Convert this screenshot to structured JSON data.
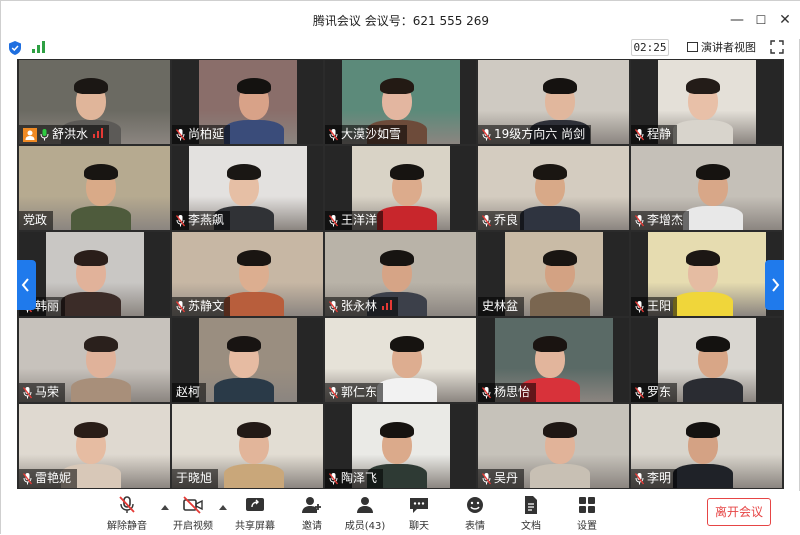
{
  "window": {
    "title": "腾讯会议 会议号：621 555 269"
  },
  "controls": {
    "minimize": "—",
    "maximize": "☐",
    "close": "✕"
  },
  "status": {
    "timer": "02:25",
    "speaker_view": "演讲者视图"
  },
  "participants": [
    {
      "name": "舒洪水",
      "tone": "#6b6a62",
      "skin": "#e0b59a",
      "hair": "#1b1714",
      "shirt": "#5c5a57",
      "accent": "#2b74d8"
    },
    {
      "name": "尚柏延",
      "tone": "#8a6e6a",
      "skin": "#d8a288",
      "hair": "#141210",
      "shirt": "#3a4c7a"
    },
    {
      "name": "大漠沙如雪",
      "tone": "#5c8a7a",
      "skin": "#e3b6a0",
      "hair": "#231a14",
      "shirt": "#6d4b3a"
    },
    {
      "name": "19级方向六 尚剑",
      "tone": "#cfcac2",
      "skin": "#e1b79d",
      "hair": "#151210",
      "shirt": "#2e3038"
    },
    {
      "name": "程静",
      "tone": "#e4e0d8",
      "skin": "#e8c0a8",
      "hair": "#231c18",
      "shirt": "#d8d4cc"
    },
    {
      "name": "党政",
      "tone": "#b6aa90",
      "skin": "#d9aa88",
      "hair": "#181512",
      "shirt": "#4e5b3c"
    },
    {
      "name": "李燕飙",
      "tone": "#e3e1df",
      "skin": "#e6bfa5",
      "hair": "#1a1714",
      "shirt": "#303236"
    },
    {
      "name": "王洋洋",
      "tone": "#d9d3c6",
      "skin": "#dcab8c",
      "hair": "#171411",
      "shirt": "#c8262c"
    },
    {
      "name": "乔良",
      "tone": "#d4ccc0",
      "skin": "#d8a988",
      "hair": "#1a1612",
      "shirt": "#2f3440"
    },
    {
      "name": "李增杰",
      "tone": "#c5c0b8",
      "skin": "#d8a788",
      "hair": "#161310",
      "shirt": "#e8e8e8"
    },
    {
      "name": "韩丽",
      "tone": "#c9c7c4",
      "skin": "#e1b29a",
      "hair": "#2a1e1a",
      "shirt": "#3b2c28"
    },
    {
      "name": "苏静文",
      "tone": "#c7b7a4",
      "skin": "#dcae90",
      "hair": "#1a1512",
      "shirt": "#b85e3c"
    },
    {
      "name": "张永林",
      "tone": "#b9b3a8",
      "skin": "#d6a486",
      "hair": "#171411",
      "shirt": "#3c404a"
    },
    {
      "name": "史林盆",
      "tone": "#c9bba6",
      "skin": "#d3a283",
      "hair": "#191512",
      "shirt": "#7a6650"
    },
    {
      "name": "王阳",
      "tone": "#e6dcb0",
      "skin": "#e5bca2",
      "hair": "#1c1714",
      "shirt": "#f0d63a"
    },
    {
      "name": "马荣",
      "tone": "#c7c2bc",
      "skin": "#e0b29a",
      "hair": "#2a201c",
      "shirt": "#a88f7a"
    },
    {
      "name": "赵柯",
      "tone": "#9a8e80",
      "skin": "#e6bba2",
      "hair": "#181412",
      "shirt": "#2a3a48"
    },
    {
      "name": "郭仁东",
      "tone": "#e6e2d8",
      "skin": "#ddad90",
      "hair": "#161310",
      "shirt": "#f2f2f2"
    },
    {
      "name": "杨思怡",
      "tone": "#5a6a66",
      "skin": "#e2b59c",
      "hair": "#1a1411",
      "shirt": "#d8323a"
    },
    {
      "name": "罗东",
      "tone": "#d9d6d0",
      "skin": "#d8a687",
      "hair": "#141210",
      "shirt": "#2a2c32"
    },
    {
      "name": "雷艳妮",
      "tone": "#dfd9d0",
      "skin": "#e6bca2",
      "hair": "#2a1e18",
      "shirt": "#d8c8b8"
    },
    {
      "name": "于晓旭",
      "tone": "#e2ddd3",
      "skin": "#e2b59a",
      "hair": "#231a16",
      "shirt": "#c9a77a"
    },
    {
      "name": "陶泽飞",
      "tone": "#eaeae6",
      "skin": "#dbaa8b",
      "hair": "#161310",
      "shirt": "#2e3a34"
    },
    {
      "name": "吴丹",
      "tone": "#c6c2ba",
      "skin": "#e1b399",
      "hair": "#1e1714",
      "shirt": "#c8c0b4"
    },
    {
      "name": "李明",
      "tone": "#d9d5cc",
      "skin": "#d4a284",
      "hair": "#141210",
      "shirt": "#1f2228"
    }
  ],
  "bottom": {
    "unmute": "解除静音",
    "start_video": "开启视频",
    "share_screen": "共享屏幕",
    "invite": "邀请",
    "members": "成员(43)",
    "chat": "聊天",
    "reactions": "表情",
    "docs": "文档",
    "settings": "设置",
    "leave": "离开会议"
  }
}
